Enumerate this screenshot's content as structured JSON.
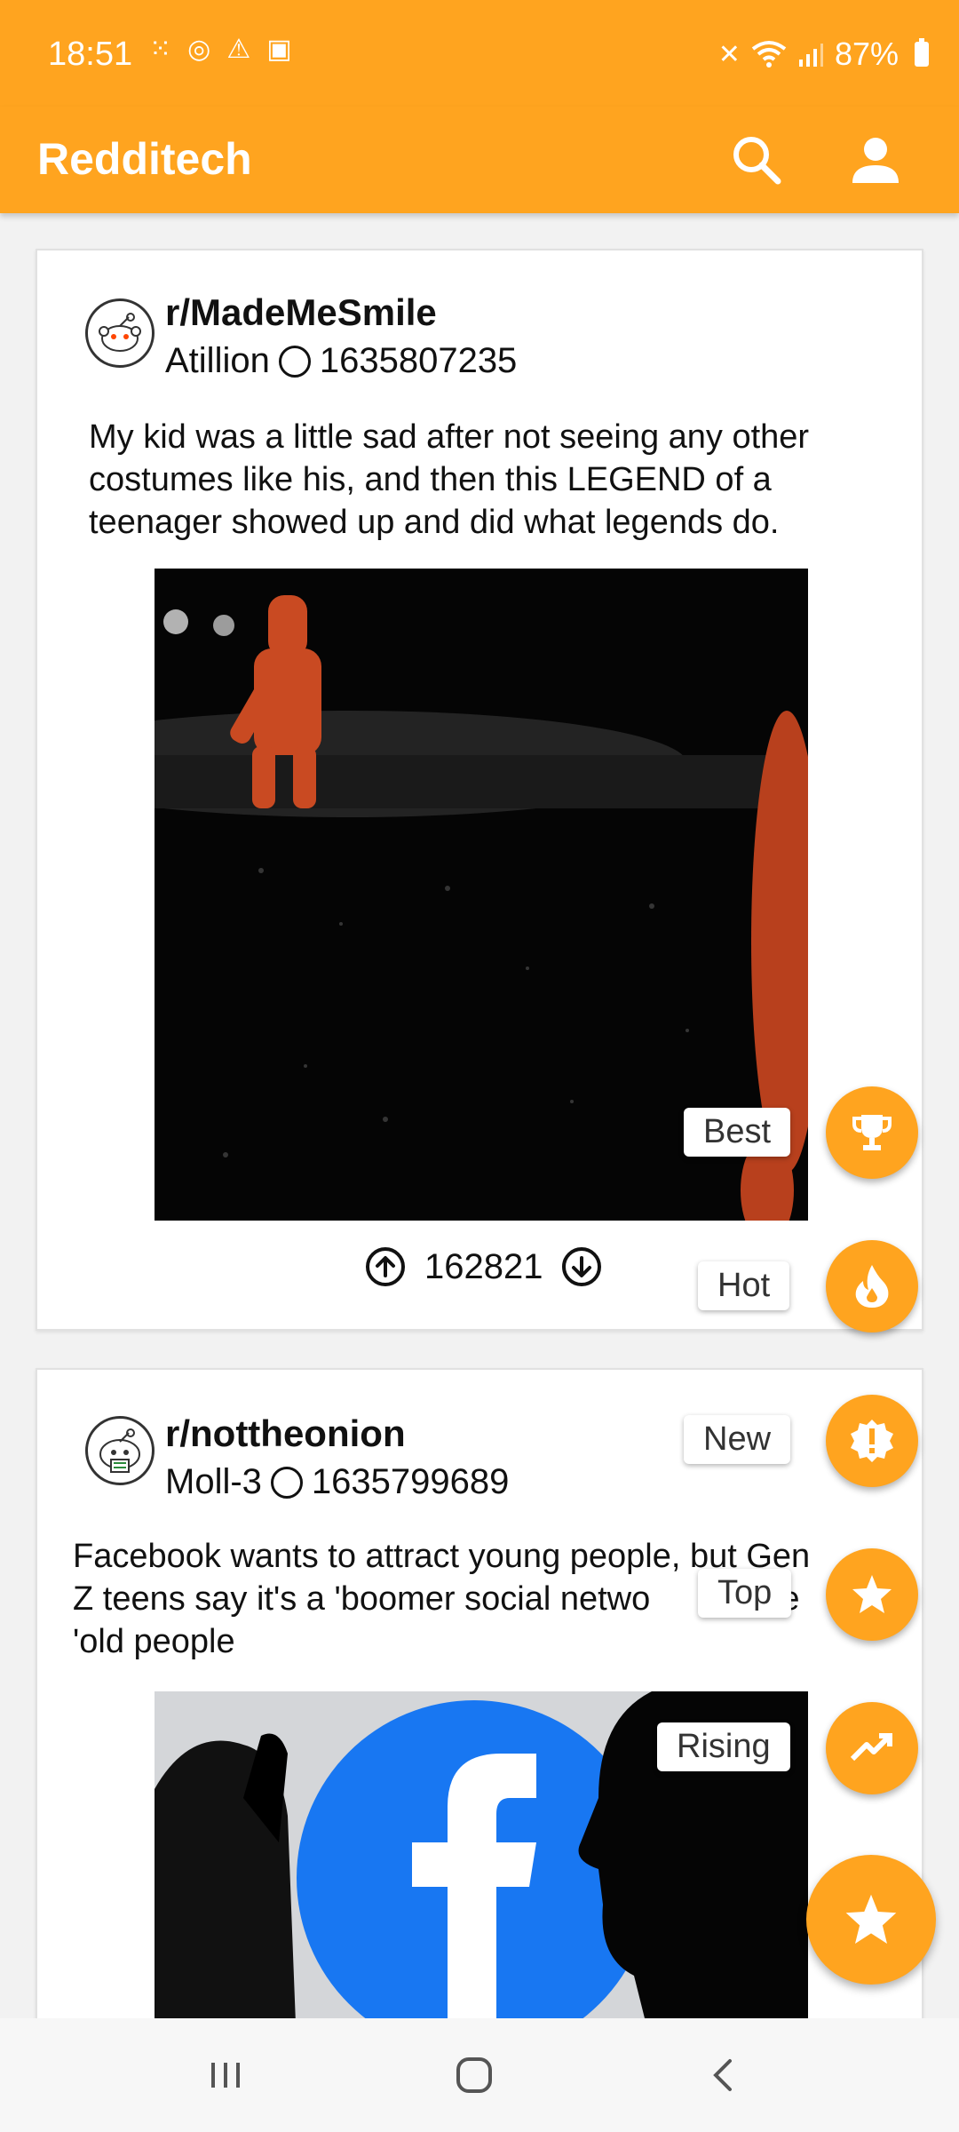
{
  "status_bar": {
    "time": "18:51",
    "battery": "87%"
  },
  "app_bar": {
    "title": "Redditech",
    "icons": [
      "search-icon",
      "account-icon"
    ]
  },
  "posts": [
    {
      "subreddit": "r/MadeMeSmile",
      "author": "Atillion",
      "timestamp": "1635807235",
      "title": "My kid was a little sad after not seeing any other costumes like his, and then this LEGEND of a teenager showed up and did what legends do.",
      "score": "162821"
    },
    {
      "subreddit": "r/nottheonion",
      "author": "Moll-3",
      "timestamp": "1635799689",
      "title_line1": "Facebook wants to attract young people, but Gen",
      "title_line2": "Z teens say it's a 'boomer social netwo",
      "title_line2_tail": "de",
      "title_line3": "'old people"
    }
  ],
  "sort_menu": {
    "items": [
      {
        "label": "Best",
        "icon": "trophy-icon"
      },
      {
        "label": "Hot",
        "icon": "fire-icon"
      },
      {
        "label": "New",
        "icon": "new-badge-icon"
      },
      {
        "label": "Top",
        "icon": "star-icon"
      },
      {
        "label": "Rising",
        "icon": "trending-up-icon"
      }
    ],
    "main_icon": "star-icon"
  },
  "nav_bar": {
    "icons": [
      "recent-apps-icon",
      "home-icon",
      "back-icon"
    ]
  },
  "colors": {
    "accent": "#ffa41f",
    "card_bg": "#ffffff",
    "page_bg": "#f2f2f2"
  }
}
